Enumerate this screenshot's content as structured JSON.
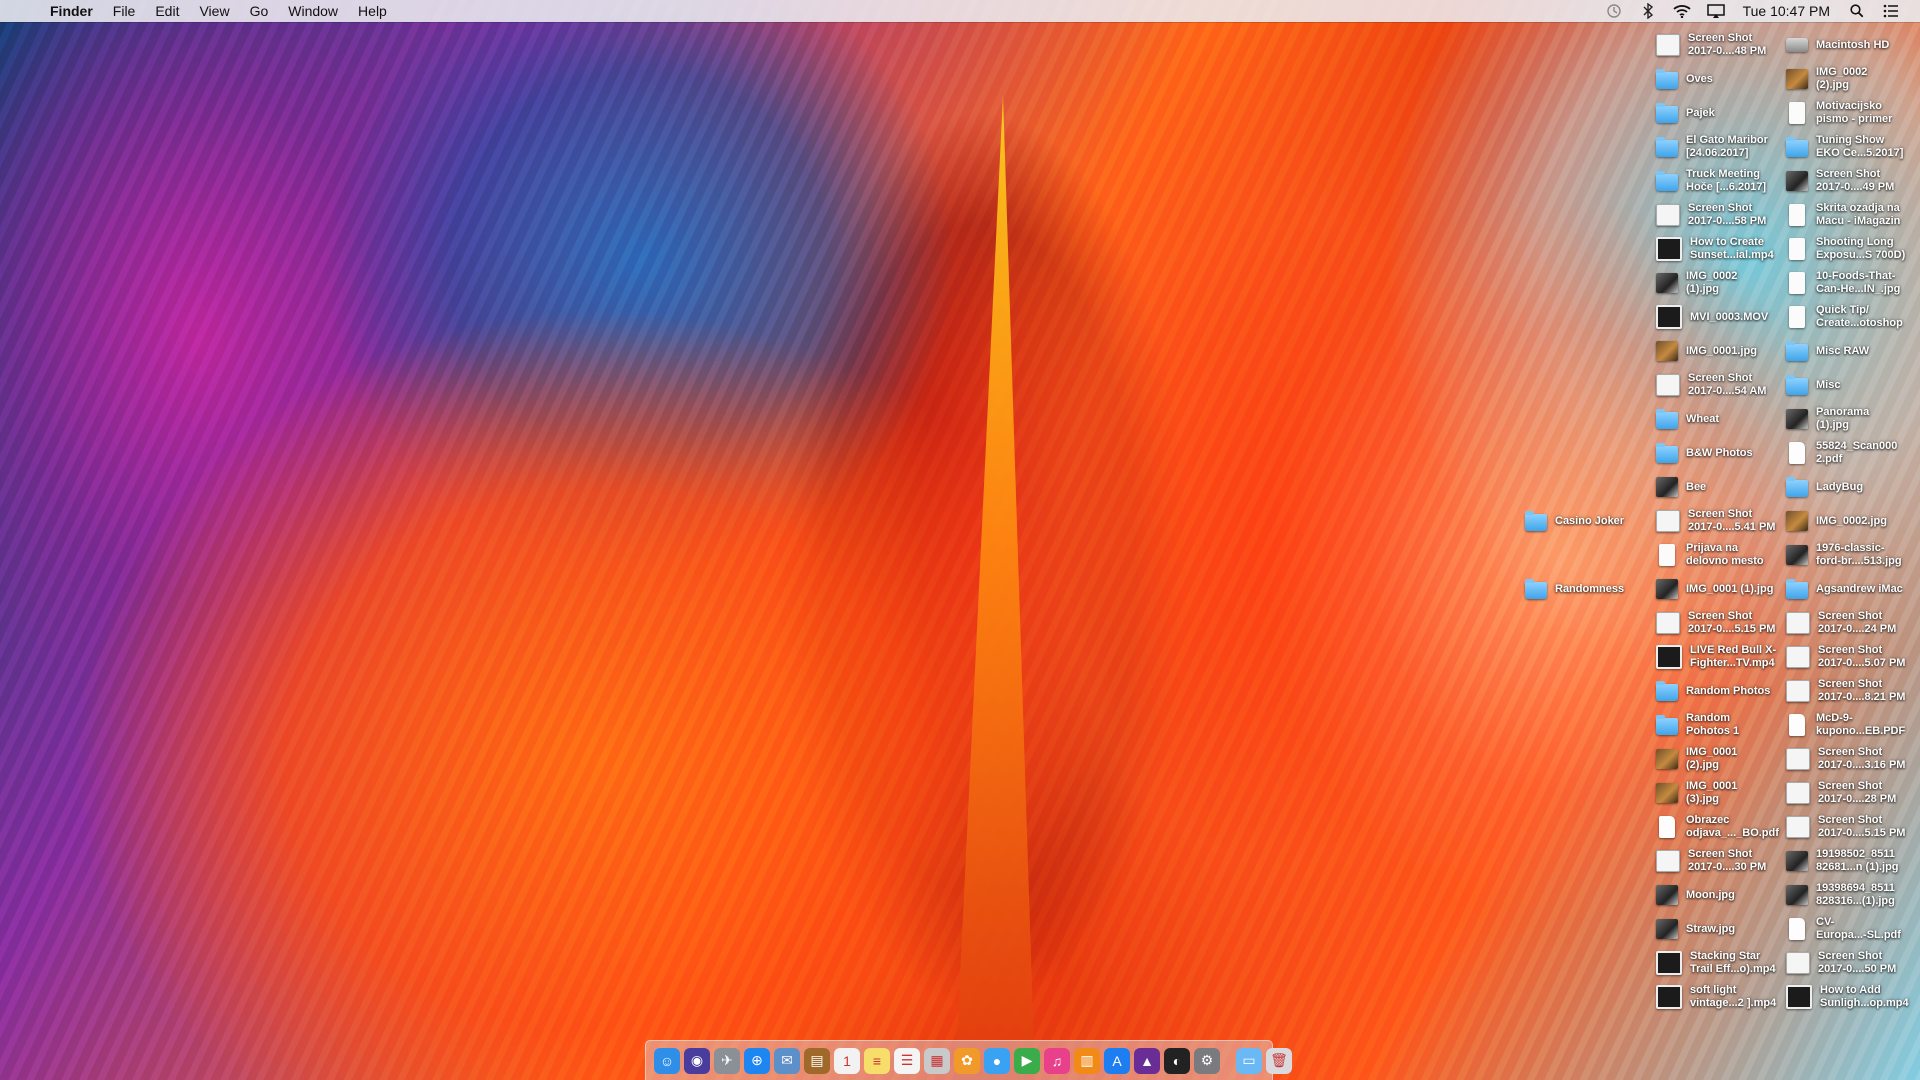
{
  "menubar": {
    "apple": "",
    "items": [
      "Finder",
      "File",
      "Edit",
      "View",
      "Go",
      "Window",
      "Help"
    ],
    "clock": "Tue 10:47 PM",
    "status_icons": [
      "time-machine-icon",
      "bluetooth-icon",
      "wifi-icon",
      "airplay-icon",
      "spotlight-search-icon",
      "notification-center-icon"
    ]
  },
  "desktop": {
    "icons": [
      {
        "label": "Screen Shot\n2017-0....48 PM",
        "kind": "shot",
        "col": 2,
        "row": 0
      },
      {
        "label": "Macintosh HD",
        "kind": "drive",
        "col": 3,
        "row": 0
      },
      {
        "label": "Oves",
        "kind": "folder",
        "col": 2,
        "row": 1
      },
      {
        "label": "IMG_0002\n(2).jpg",
        "kind": "photo",
        "col": 3,
        "row": 1
      },
      {
        "label": "Pajek",
        "kind": "folder",
        "col": 2,
        "row": 2
      },
      {
        "label": "Motivacijsko\npismo - primer",
        "kind": "doc",
        "col": 3,
        "row": 2
      },
      {
        "label": "El Gato Maribor\n[24.06.2017]",
        "kind": "folder",
        "col": 2,
        "row": 3
      },
      {
        "label": "Tuning Show\nEKO Ce...5.2017]",
        "kind": "folder",
        "col": 3,
        "row": 3
      },
      {
        "label": "Truck Meeting\nHoče [...6.2017]",
        "kind": "folder",
        "col": 2,
        "row": 4
      },
      {
        "label": "Screen Shot\n2017-0....49 PM",
        "kind": "image",
        "col": 3,
        "row": 4
      },
      {
        "label": "Screen Shot\n2017-0....58 PM",
        "kind": "shot",
        "col": 2,
        "row": 5
      },
      {
        "label": "Skrita ozadja na\nMacu - iMagazin",
        "kind": "doc",
        "col": 3,
        "row": 5
      },
      {
        "label": "How to Create\nSunset...ial.mp4",
        "kind": "video",
        "col": 2,
        "row": 6
      },
      {
        "label": "Shooting Long\nExposu...S 700D)",
        "kind": "doc",
        "col": 3,
        "row": 6
      },
      {
        "label": "IMG_0002\n(1).jpg",
        "kind": "image",
        "col": 2,
        "row": 7
      },
      {
        "label": "10-Foods-That-\nCan-He...IN_.jpg",
        "kind": "doc",
        "col": 3,
        "row": 7
      },
      {
        "label": "MVI_0003.MOV",
        "kind": "video",
        "col": 2,
        "row": 8
      },
      {
        "label": "Quick Tip/\nCreate...otoshop",
        "kind": "doc",
        "col": 3,
        "row": 8
      },
      {
        "label": "IMG_0001.jpg",
        "kind": "photo",
        "col": 2,
        "row": 9
      },
      {
        "label": "Misc RAW",
        "kind": "folder",
        "col": 3,
        "row": 9
      },
      {
        "label": "Screen Shot\n2017-0....54 AM",
        "kind": "shot",
        "col": 2,
        "row": 10
      },
      {
        "label": "Misc",
        "kind": "folder",
        "col": 3,
        "row": 10
      },
      {
        "label": "Wheat",
        "kind": "folder",
        "col": 2,
        "row": 11
      },
      {
        "label": "Panorama\n(1).jpg",
        "kind": "image",
        "col": 3,
        "row": 11
      },
      {
        "label": "B&W Photos",
        "kind": "folder",
        "col": 2,
        "row": 12
      },
      {
        "label": "55824_Scan000\n2.pdf",
        "kind": "pdf",
        "col": 3,
        "row": 12
      },
      {
        "label": "Bee",
        "kind": "image",
        "col": 2,
        "row": 13
      },
      {
        "label": "LadyBug",
        "kind": "folder",
        "col": 3,
        "row": 13
      },
      {
        "label": "Casino Joker",
        "kind": "folder",
        "col": 1,
        "row": 14
      },
      {
        "label": "Screen Shot\n2017-0....5.41 PM",
        "kind": "shot",
        "col": 2,
        "row": 14
      },
      {
        "label": "IMG_0002.jpg",
        "kind": "photo",
        "col": 3,
        "row": 14
      },
      {
        "label": "Prijava na\ndelovno mesto",
        "kind": "doc",
        "col": 2,
        "row": 15
      },
      {
        "label": "1976-classic-\nford-br....513.jpg",
        "kind": "image",
        "col": 3,
        "row": 15
      },
      {
        "label": "Randomness",
        "kind": "folder",
        "col": 1,
        "row": 16
      },
      {
        "label": "IMG_0001 (1).jpg",
        "kind": "image",
        "col": 2,
        "row": 16
      },
      {
        "label": "Agsandrew iMac",
        "kind": "folder",
        "col": 3,
        "row": 16
      },
      {
        "label": "Screen Shot\n2017-0....5.15 PM",
        "kind": "shot",
        "col": 2,
        "row": 17
      },
      {
        "label": "Screen Shot\n2017-0....24 PM",
        "kind": "shot",
        "col": 3,
        "row": 17
      },
      {
        "label": "LIVE Red Bull X-\nFighter...TV.mp4",
        "kind": "video",
        "col": 2,
        "row": 18
      },
      {
        "label": "Screen Shot\n2017-0....5.07 PM",
        "kind": "shot",
        "col": 3,
        "row": 18
      },
      {
        "label": "Random Photos",
        "kind": "folder",
        "col": 2,
        "row": 19
      },
      {
        "label": "Screen Shot\n2017-0....8.21 PM",
        "kind": "shot",
        "col": 3,
        "row": 19
      },
      {
        "label": "Random\nPohotos 1",
        "kind": "folder",
        "col": 2,
        "row": 20
      },
      {
        "label": "McD-9-\nkupono...EB.PDF",
        "kind": "pdf",
        "col": 3,
        "row": 20
      },
      {
        "label": "IMG_0001\n(2).jpg",
        "kind": "photo",
        "col": 2,
        "row": 21
      },
      {
        "label": "Screen Shot\n2017-0....3.16 PM",
        "kind": "shot",
        "col": 3,
        "row": 21
      },
      {
        "label": "IMG_0001\n(3).jpg",
        "kind": "photo",
        "col": 2,
        "row": 22
      },
      {
        "label": "Screen Shot\n2017-0....28 PM",
        "kind": "shot",
        "col": 3,
        "row": 22
      },
      {
        "label": "Obrazec\nodjava_..._BO.pdf",
        "kind": "pdf",
        "col": 2,
        "row": 23
      },
      {
        "label": "Screen Shot\n2017-0....5.15 PM",
        "kind": "shot",
        "col": 3,
        "row": 23
      },
      {
        "label": "Screen Shot\n2017-0....30 PM",
        "kind": "shot",
        "col": 2,
        "row": 24
      },
      {
        "label": "19198502_8511\n82681...n (1).jpg",
        "kind": "image",
        "col": 3,
        "row": 24
      },
      {
        "label": "Moon.jpg",
        "kind": "image",
        "col": 2,
        "row": 25
      },
      {
        "label": "19398694_8511\n828316...(1).jpg",
        "kind": "image",
        "col": 3,
        "row": 25
      },
      {
        "label": "Straw.jpg",
        "kind": "image",
        "col": 2,
        "row": 26
      },
      {
        "label": "CV-\nEuropa...-SL.pdf",
        "kind": "pdf",
        "col": 3,
        "row": 26
      },
      {
        "label": "Stacking Star\nTrail Eff...o).mp4",
        "kind": "video",
        "col": 2,
        "row": 27
      },
      {
        "label": "Screen Shot\n2017-0....50 PM",
        "kind": "shot",
        "col": 3,
        "row": 27
      },
      {
        "label": "soft light\nvintage...2 ].mp4",
        "kind": "video",
        "col": 2,
        "row": 28
      },
      {
        "label": "How to Add\nSunligh...op.mp4",
        "kind": "video",
        "col": 3,
        "row": 28
      }
    ]
  },
  "dock": {
    "apps": [
      {
        "name": "finder-icon",
        "color": "#2f8fe8",
        "glyph": "☺"
      },
      {
        "name": "siri-icon",
        "color": "#4a3c9c",
        "glyph": "◉"
      },
      {
        "name": "launchpad-icon",
        "color": "#8b8f96",
        "glyph": "✈"
      },
      {
        "name": "safari-icon",
        "color": "#1e86f0",
        "glyph": "⊕"
      },
      {
        "name": "mail-icon",
        "color": "#5d8fc9",
        "glyph": "✉"
      },
      {
        "name": "notes-book-icon",
        "color": "#a0692a",
        "glyph": "▤"
      },
      {
        "name": "calendar-icon",
        "color": "#f2f2f2",
        "glyph": "1"
      },
      {
        "name": "notes-icon",
        "color": "#f7dd6a",
        "glyph": "≡"
      },
      {
        "name": "reminders-icon",
        "color": "#f4f4f4",
        "glyph": "☰"
      },
      {
        "name": "keynote-icon",
        "color": "#c9c9c9",
        "glyph": "▦"
      },
      {
        "name": "photos-icon",
        "color": "#f19a2a",
        "glyph": "✿"
      },
      {
        "name": "messages-icon",
        "color": "#3aa2f3",
        "glyph": "●"
      },
      {
        "name": "facetime-icon",
        "color": "#3aad4a",
        "glyph": "▶"
      },
      {
        "name": "itunes-icon",
        "color": "#e8408a",
        "glyph": "♫"
      },
      {
        "name": "ibooks-icon",
        "color": "#f28a18",
        "glyph": "▥"
      },
      {
        "name": "app-store-icon",
        "color": "#1d7ef2",
        "glyph": "A"
      },
      {
        "name": "affinity-photo-icon",
        "color": "#6a2d96",
        "glyph": "▲"
      },
      {
        "name": "camera-raw-icon",
        "color": "#222222",
        "glyph": "◐"
      },
      {
        "name": "system-preferences-icon",
        "color": "#7a7a7f",
        "glyph": "⚙"
      }
    ],
    "right": [
      {
        "name": "downloads-folder-icon",
        "color": "#6ab8f4",
        "glyph": "▭"
      },
      {
        "name": "trash-icon",
        "color": "#d9d9de",
        "glyph": "🗑"
      }
    ]
  }
}
